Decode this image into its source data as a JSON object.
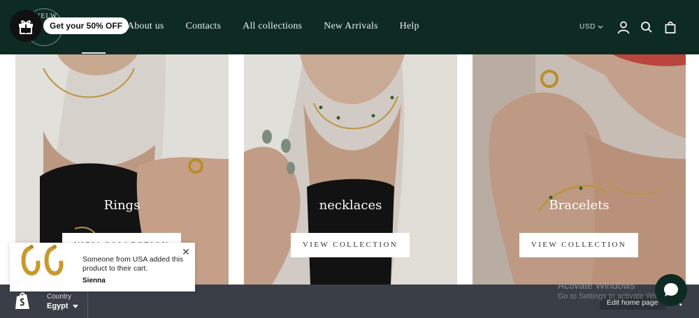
{
  "header": {
    "logo_text": "VELW",
    "promo": "Get your 50% OFF",
    "nav": [
      "About us",
      "Contacts",
      "All collections",
      "New Arrivals",
      "Help"
    ],
    "currency": "USD",
    "icons": [
      "account-icon",
      "search-icon",
      "bag-icon"
    ]
  },
  "collections": [
    {
      "title": "Rings",
      "button": "VIEW COLLECTION"
    },
    {
      "title": "necklaces",
      "button": "VIEW COLLECTION"
    },
    {
      "title": "Bracelets",
      "button": "VIEW COLLECTION"
    }
  ],
  "popup": {
    "message": "Someone from USA added this product to their cart.",
    "customer": "Sienna"
  },
  "bottombar": {
    "country_label": "Country",
    "country_value": "Egypt",
    "edit_button": "Edit home page"
  },
  "watermark": {
    "line1": "Activate Windows",
    "line2": "Go to Settings to activate Windows."
  },
  "colors": {
    "header_bg": "#0d2b22",
    "bottombar_bg": "#3a3f47",
    "button_bg": "#ffffff"
  }
}
